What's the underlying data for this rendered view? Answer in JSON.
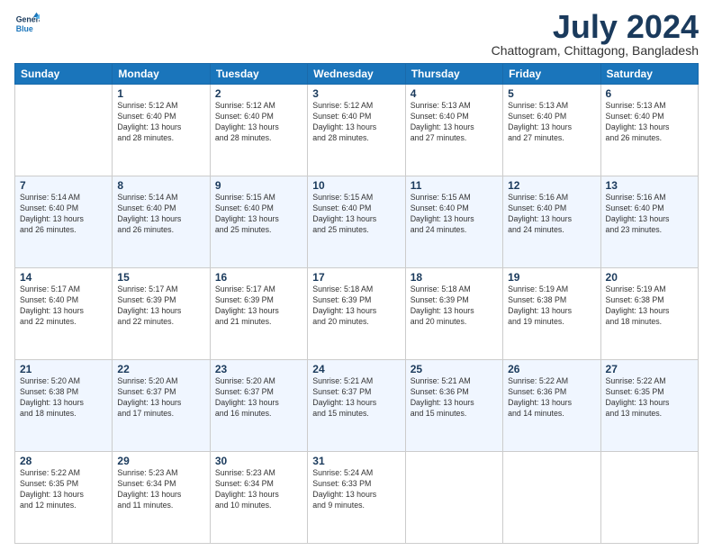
{
  "logo": {
    "line1": "General",
    "line2": "Blue"
  },
  "title": "July 2024",
  "subtitle": "Chattogram, Chittagong, Bangladesh",
  "days_header": [
    "Sunday",
    "Monday",
    "Tuesday",
    "Wednesday",
    "Thursday",
    "Friday",
    "Saturday"
  ],
  "weeks": [
    [
      {
        "num": "",
        "info": ""
      },
      {
        "num": "1",
        "info": "Sunrise: 5:12 AM\nSunset: 6:40 PM\nDaylight: 13 hours\nand 28 minutes."
      },
      {
        "num": "2",
        "info": "Sunrise: 5:12 AM\nSunset: 6:40 PM\nDaylight: 13 hours\nand 28 minutes."
      },
      {
        "num": "3",
        "info": "Sunrise: 5:12 AM\nSunset: 6:40 PM\nDaylight: 13 hours\nand 28 minutes."
      },
      {
        "num": "4",
        "info": "Sunrise: 5:13 AM\nSunset: 6:40 PM\nDaylight: 13 hours\nand 27 minutes."
      },
      {
        "num": "5",
        "info": "Sunrise: 5:13 AM\nSunset: 6:40 PM\nDaylight: 13 hours\nand 27 minutes."
      },
      {
        "num": "6",
        "info": "Sunrise: 5:13 AM\nSunset: 6:40 PM\nDaylight: 13 hours\nand 26 minutes."
      }
    ],
    [
      {
        "num": "7",
        "info": "Sunrise: 5:14 AM\nSunset: 6:40 PM\nDaylight: 13 hours\nand 26 minutes."
      },
      {
        "num": "8",
        "info": "Sunrise: 5:14 AM\nSunset: 6:40 PM\nDaylight: 13 hours\nand 26 minutes."
      },
      {
        "num": "9",
        "info": "Sunrise: 5:15 AM\nSunset: 6:40 PM\nDaylight: 13 hours\nand 25 minutes."
      },
      {
        "num": "10",
        "info": "Sunrise: 5:15 AM\nSunset: 6:40 PM\nDaylight: 13 hours\nand 25 minutes."
      },
      {
        "num": "11",
        "info": "Sunrise: 5:15 AM\nSunset: 6:40 PM\nDaylight: 13 hours\nand 24 minutes."
      },
      {
        "num": "12",
        "info": "Sunrise: 5:16 AM\nSunset: 6:40 PM\nDaylight: 13 hours\nand 24 minutes."
      },
      {
        "num": "13",
        "info": "Sunrise: 5:16 AM\nSunset: 6:40 PM\nDaylight: 13 hours\nand 23 minutes."
      }
    ],
    [
      {
        "num": "14",
        "info": "Sunrise: 5:17 AM\nSunset: 6:40 PM\nDaylight: 13 hours\nand 22 minutes."
      },
      {
        "num": "15",
        "info": "Sunrise: 5:17 AM\nSunset: 6:39 PM\nDaylight: 13 hours\nand 22 minutes."
      },
      {
        "num": "16",
        "info": "Sunrise: 5:17 AM\nSunset: 6:39 PM\nDaylight: 13 hours\nand 21 minutes."
      },
      {
        "num": "17",
        "info": "Sunrise: 5:18 AM\nSunset: 6:39 PM\nDaylight: 13 hours\nand 20 minutes."
      },
      {
        "num": "18",
        "info": "Sunrise: 5:18 AM\nSunset: 6:39 PM\nDaylight: 13 hours\nand 20 minutes."
      },
      {
        "num": "19",
        "info": "Sunrise: 5:19 AM\nSunset: 6:38 PM\nDaylight: 13 hours\nand 19 minutes."
      },
      {
        "num": "20",
        "info": "Sunrise: 5:19 AM\nSunset: 6:38 PM\nDaylight: 13 hours\nand 18 minutes."
      }
    ],
    [
      {
        "num": "21",
        "info": "Sunrise: 5:20 AM\nSunset: 6:38 PM\nDaylight: 13 hours\nand 18 minutes."
      },
      {
        "num": "22",
        "info": "Sunrise: 5:20 AM\nSunset: 6:37 PM\nDaylight: 13 hours\nand 17 minutes."
      },
      {
        "num": "23",
        "info": "Sunrise: 5:20 AM\nSunset: 6:37 PM\nDaylight: 13 hours\nand 16 minutes."
      },
      {
        "num": "24",
        "info": "Sunrise: 5:21 AM\nSunset: 6:37 PM\nDaylight: 13 hours\nand 15 minutes."
      },
      {
        "num": "25",
        "info": "Sunrise: 5:21 AM\nSunset: 6:36 PM\nDaylight: 13 hours\nand 15 minutes."
      },
      {
        "num": "26",
        "info": "Sunrise: 5:22 AM\nSunset: 6:36 PM\nDaylight: 13 hours\nand 14 minutes."
      },
      {
        "num": "27",
        "info": "Sunrise: 5:22 AM\nSunset: 6:35 PM\nDaylight: 13 hours\nand 13 minutes."
      }
    ],
    [
      {
        "num": "28",
        "info": "Sunrise: 5:22 AM\nSunset: 6:35 PM\nDaylight: 13 hours\nand 12 minutes."
      },
      {
        "num": "29",
        "info": "Sunrise: 5:23 AM\nSunset: 6:34 PM\nDaylight: 13 hours\nand 11 minutes."
      },
      {
        "num": "30",
        "info": "Sunrise: 5:23 AM\nSunset: 6:34 PM\nDaylight: 13 hours\nand 10 minutes."
      },
      {
        "num": "31",
        "info": "Sunrise: 5:24 AM\nSunset: 6:33 PM\nDaylight: 13 hours\nand 9 minutes."
      },
      {
        "num": "",
        "info": ""
      },
      {
        "num": "",
        "info": ""
      },
      {
        "num": "",
        "info": ""
      }
    ]
  ]
}
